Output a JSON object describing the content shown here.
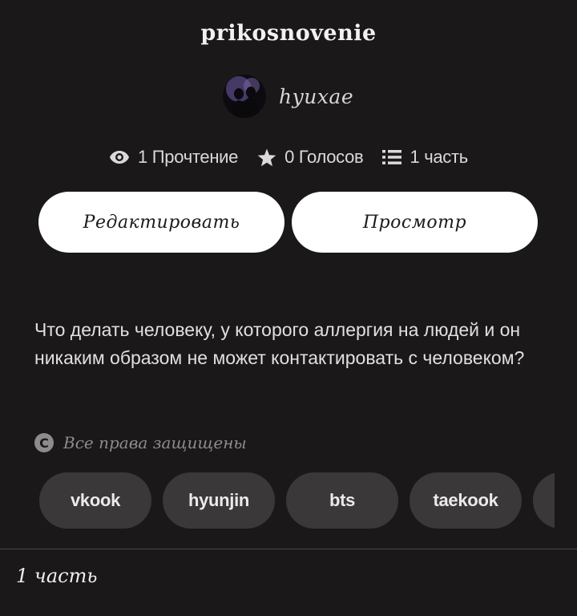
{
  "story": {
    "title": "prikosnovenie",
    "author": "hyuxae",
    "description": "Что делать человеку, у которого аллергия на людей и он никаким образом не может контактировать с человеком?",
    "rights": "Все права защищены"
  },
  "stats": {
    "reads": "1 Прочтение",
    "votes": "0 Голосов",
    "parts": "1 часть"
  },
  "actions": {
    "edit_label": "Редактировать",
    "view_label": "Просмотр"
  },
  "tags": [
    "vkook",
    "hyunjin",
    "bts",
    "taekook",
    ""
  ],
  "parts_list": {
    "first_part": "1 часть"
  },
  "icons": {
    "reads": "eye-icon",
    "votes": "star-icon",
    "parts": "list-icon",
    "rights": "copyright-icon"
  },
  "colors": {
    "background": "#1a1819",
    "button": "#ffffff",
    "tag": "#3b3839",
    "muted": "#8e8b8c"
  }
}
